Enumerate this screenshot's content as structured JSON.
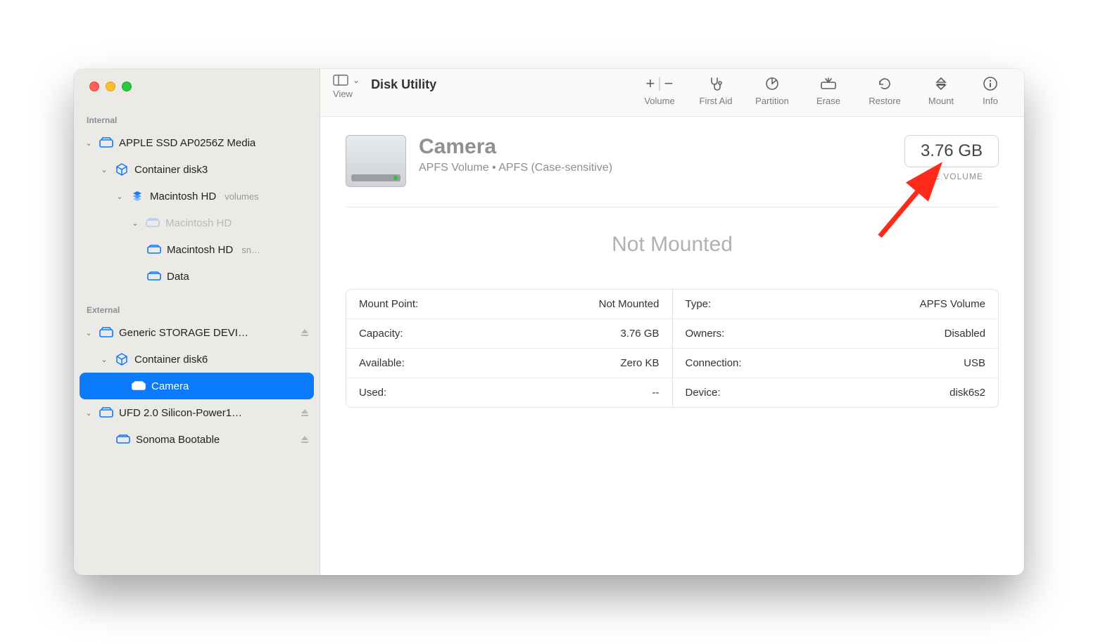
{
  "toolbar": {
    "view_label": "View",
    "title": "Disk Utility",
    "buttons": {
      "volume": "Volume",
      "first_aid": "First Aid",
      "partition": "Partition",
      "erase": "Erase",
      "restore": "Restore",
      "mount": "Mount",
      "info": "Info"
    }
  },
  "sidebar": {
    "sections": {
      "internal_label": "Internal",
      "external_label": "External"
    },
    "internal": {
      "disk": "APPLE SSD AP0256Z Media",
      "container": "Container disk3",
      "volume_group": "Macintosh HD",
      "volume_group_suffix": "volumes",
      "mac_hd_dim": "Macintosh HD",
      "mac_hd": "Macintosh HD",
      "mac_hd_suffix": "sn…",
      "data": "Data"
    },
    "external": {
      "disk1": "Generic STORAGE DEVI…",
      "container": "Container disk6",
      "camera": "Camera",
      "disk2": "UFD 2.0 Silicon-Power1…",
      "sonoma": "Sonoma Bootable"
    }
  },
  "volume": {
    "name": "Camera",
    "subtitle": "APFS Volume • APFS (Case-sensitive)",
    "size": "3.76 GB",
    "size_caption": "ONE VOLUME",
    "status": "Not Mounted",
    "details": {
      "mount_point_k": "Mount Point:",
      "mount_point_v": "Not Mounted",
      "capacity_k": "Capacity:",
      "capacity_v": "3.76 GB",
      "available_k": "Available:",
      "available_v": "Zero KB",
      "used_k": "Used:",
      "used_v": "--",
      "type_k": "Type:",
      "type_v": "APFS Volume",
      "owners_k": "Owners:",
      "owners_v": "Disabled",
      "connection_k": "Connection:",
      "connection_v": "USB",
      "device_k": "Device:",
      "device_v": "disk6s2"
    }
  }
}
